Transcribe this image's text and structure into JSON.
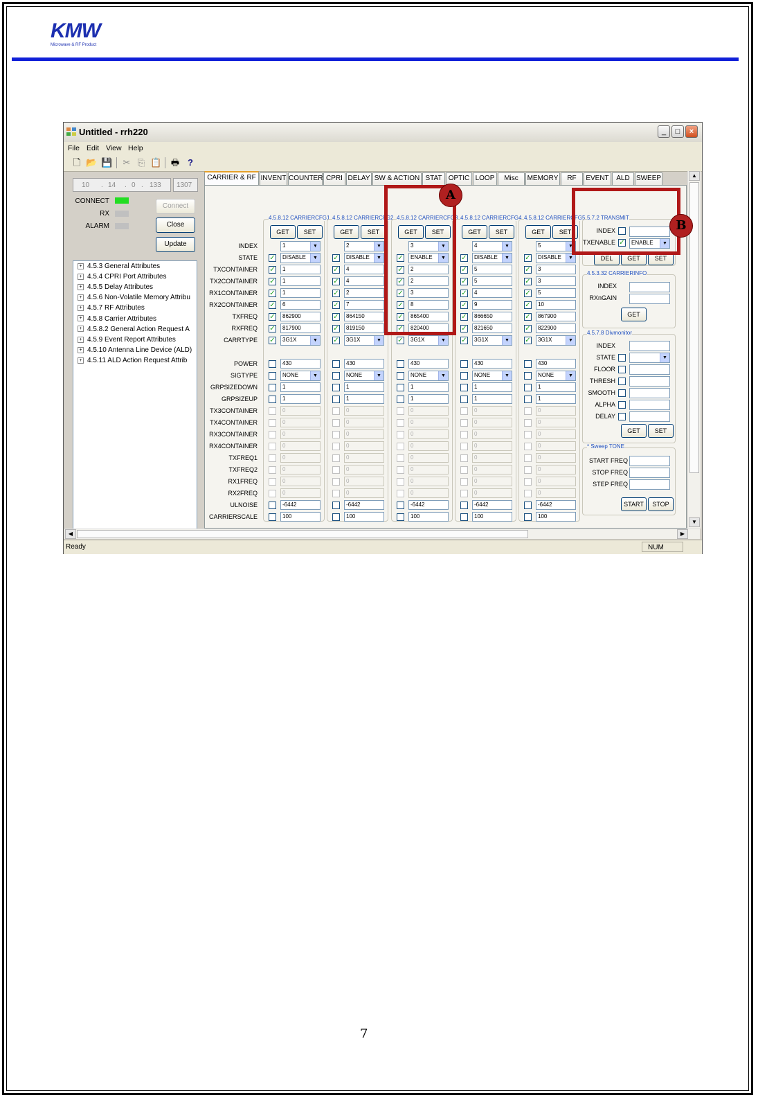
{
  "logo": {
    "text": "KMW",
    "subtitle": "Microwave & RF Product"
  },
  "page_number": "7",
  "window": {
    "title": "Untitled - rrh220",
    "controls": [
      "_",
      "□",
      "×"
    ],
    "menu": [
      "File",
      "Edit",
      "View",
      "Help"
    ],
    "toolbar_icons": [
      "new-file-icon",
      "open-folder-icon",
      "save-icon",
      "cut-icon",
      "copy-icon",
      "paste-icon",
      "print-icon",
      "help-icon"
    ],
    "status": {
      "text": "Ready",
      "num": "NUM"
    }
  },
  "connection": {
    "ip": [
      "10",
      "14",
      "0",
      "133"
    ],
    "port": "1307",
    "indicators": [
      {
        "label": "CONNECT",
        "color": "#22dd22"
      },
      {
        "label": "RX",
        "color": "#c0c0c0"
      },
      {
        "label": "ALARM",
        "color": "#c0c0c0"
      }
    ],
    "buttons": {
      "connect": "Connect",
      "close": "Close",
      "update": "Update"
    }
  },
  "tree": [
    "4.5.3 General Attributes",
    "4.5.4 CPRI Port Attributes",
    "4.5.5 Delay Attributes",
    "4.5.6 Non-Volatile Memory Attribu",
    "4.5.7 RF Attributes",
    "4.5.8 Carrier Attributes",
    "4.5.8.2 General Action Request A",
    "4.5.9 Event Report Attributes",
    "4.5.10 Antenna Line Device (ALD)",
    "4.5.11 ALD Action Request Attrib"
  ],
  "tabs": [
    "CARRIER & RF",
    "INVENT",
    "COUNTER",
    "CPRI",
    "DELAY",
    "SW & ACTION",
    "STAT",
    "OPTIC",
    "LOOP",
    "Misc",
    "MEMORY",
    "RF",
    "EVENT",
    "ALD",
    "SWEEP"
  ],
  "row_labels": [
    "INDEX",
    "STATE",
    "TXCONTAINER",
    "TX2CONTAINER",
    "RX1CONTAINER",
    "RX2CONTAINER",
    "TXFREQ",
    "RXFREQ",
    "CARRTYPE",
    "",
    "POWER",
    "SIGTYPE",
    "GRPSIZEDOWN",
    "GRPSIZEUP",
    "TX3CONTAINER",
    "TX4CONTAINER",
    "RX3CONTAINER",
    "RX4CONTAINER",
    "TXFREQ1",
    "TXFREQ2",
    "RX1FREQ",
    "RX2FREQ",
    "ULNOISE",
    "CARRIERSCALE"
  ],
  "get_label": "GET",
  "set_label": "SET",
  "carrier_groups": [
    {
      "title": "4.5.8.12 CARRIERCFG1",
      "index": "1",
      "state": "DISABLE",
      "tx": "1",
      "tx2": "1",
      "rx1": "1",
      "rx2": "6",
      "txfreq": "862900",
      "rxfreq": "817900",
      "carrtype": "3G1X",
      "power": "430",
      "sigtype": "NONE",
      "grpdown": "1",
      "grpup": "1",
      "disabled_value": "0",
      "ulnoise": "-6442",
      "scale": "100"
    },
    {
      "title": "4.5.8.12 CARRIERCFG2",
      "index": "2",
      "state": "DISABLE",
      "tx": "4",
      "tx2": "4",
      "rx1": "2",
      "rx2": "7",
      "txfreq": "864150",
      "rxfreq": "819150",
      "carrtype": "3G1X",
      "power": "430",
      "sigtype": "NONE",
      "grpdown": "1",
      "grpup": "1",
      "disabled_value": "0",
      "ulnoise": "-6442",
      "scale": "100"
    },
    {
      "title": "4.5.8.12 CARRIERCFG3",
      "index": "3",
      "state": "ENABLE",
      "tx": "2",
      "tx2": "2",
      "rx1": "3",
      "rx2": "8",
      "txfreq": "865400",
      "rxfreq": "820400",
      "carrtype": "3G1X",
      "power": "430",
      "sigtype": "NONE",
      "grpdown": "1",
      "grpup": "1",
      "disabled_value": "0",
      "ulnoise": "-6442",
      "scale": "100"
    },
    {
      "title": "4.5.8.12 CARRIERCFG4",
      "index": "4",
      "state": "DISABLE",
      "tx": "5",
      "tx2": "5",
      "rx1": "4",
      "rx2": "9",
      "txfreq": "866650",
      "rxfreq": "821650",
      "carrtype": "3G1X",
      "power": "430",
      "sigtype": "NONE",
      "grpdown": "1",
      "grpup": "1",
      "disabled_value": "0",
      "ulnoise": "-6442",
      "scale": "100"
    },
    {
      "title": "4.5.8.12 CARRIERCFG5",
      "index": "5",
      "state": "DISABLE",
      "tx": "3",
      "tx2": "3",
      "rx1": "5",
      "rx2": "10",
      "txfreq": "867900",
      "rxfreq": "822900",
      "carrtype": "3G1X",
      "power": "430",
      "sigtype": "NONE",
      "grpdown": "1",
      "grpup": "1",
      "disabled_value": "0",
      "ulnoise": "-6442",
      "scale": "100"
    }
  ],
  "transmit": {
    "title": "5.7.2 TRANSMIT",
    "index_label": "INDEX",
    "txenable_label": "TXENABLE",
    "txenable_value": "ENABLE",
    "del": "DEL",
    "get": "GET",
    "set": "SET"
  },
  "carrierinfo": {
    "title": "4.5.3.32 CARRIERINFO",
    "index_label": "INDEX",
    "rxngain_label": "RXnGAIN",
    "get": "GET"
  },
  "divmonitor": {
    "title": "4.5.7.8 Divmonitor",
    "labels": [
      "INDEX",
      "STATE",
      "FLOOR",
      "THRESH",
      "SMOOTH",
      "ALPHA",
      "DELAY"
    ],
    "get": "GET",
    "set": "SET"
  },
  "sweep": {
    "title": "* Sweep TONE",
    "labels": [
      "START FREQ",
      "STOP FREQ",
      "STEP FREQ"
    ],
    "start": "START",
    "stop": "STOP"
  },
  "callouts": [
    "A",
    "B"
  ]
}
